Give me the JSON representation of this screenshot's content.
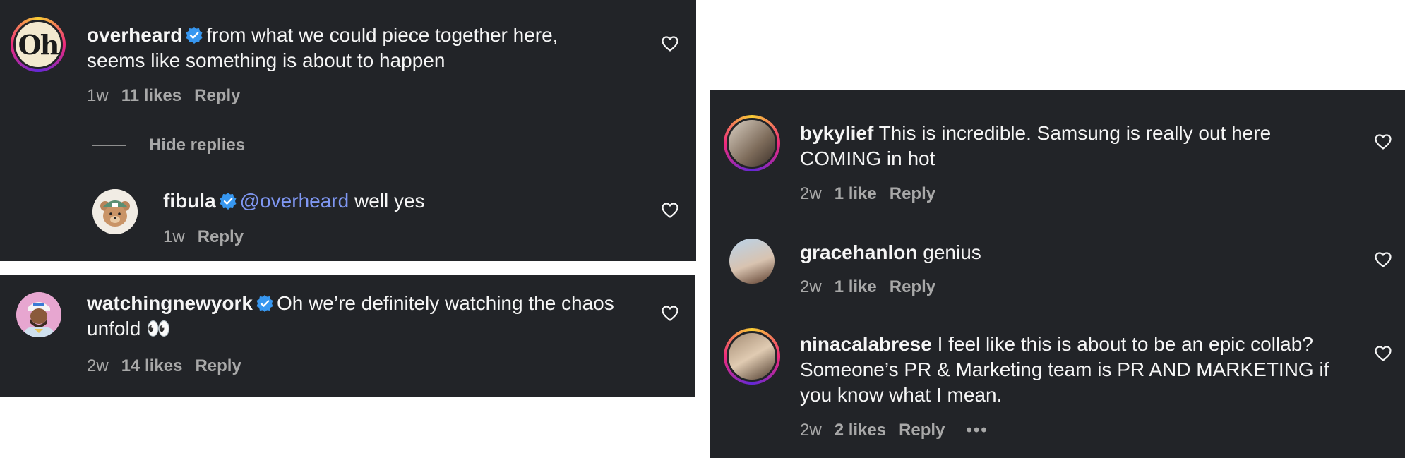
{
  "colors": {
    "panel_bg": "#222428",
    "text": "#f5f5f5",
    "meta": "#a8a8a8",
    "mention": "#7f97f2",
    "verified": "#3797f0"
  },
  "icons": {
    "heart": "heart-outline-icon",
    "verified": "verified-badge-icon"
  },
  "comments": [
    {
      "username": "overheard",
      "verified": true,
      "text": "from what we could piece together here,",
      "text_line2": "seems like something is about to happen",
      "time": "1w",
      "likes": "11 likes",
      "reply": "Reply",
      "hide_replies": "Hide replies",
      "avatar_text": "Oh",
      "replies": [
        {
          "username": "fibula",
          "verified": true,
          "mention": "@overheard",
          "text": "well yes",
          "time": "1w",
          "reply": "Reply"
        }
      ]
    },
    {
      "username": "watchingnewyork",
      "verified": true,
      "text": "Oh we’re definitely watching the chaos",
      "text_line2": "unfold 👀",
      "time": "2w",
      "likes": "14 likes",
      "reply": "Reply"
    },
    {
      "username": "bykylief",
      "verified": false,
      "text": "This is incredible. Samsung is really out here",
      "text_line2": "COMING in hot",
      "time": "2w",
      "likes": "1 like",
      "reply": "Reply"
    },
    {
      "username": "gracehanlon",
      "verified": false,
      "text": "genius",
      "time": "2w",
      "likes": "1 like",
      "reply": "Reply"
    },
    {
      "username": "ninacalabrese",
      "verified": false,
      "text": "I feel like this is about to be an epic collab?",
      "text_line2": "Someone’s PR & Marketing team is PR AND MARKETING if",
      "text_line3": "you know what I mean.",
      "time": "2w",
      "likes": "2 likes",
      "reply": "Reply",
      "more": "•••"
    }
  ]
}
